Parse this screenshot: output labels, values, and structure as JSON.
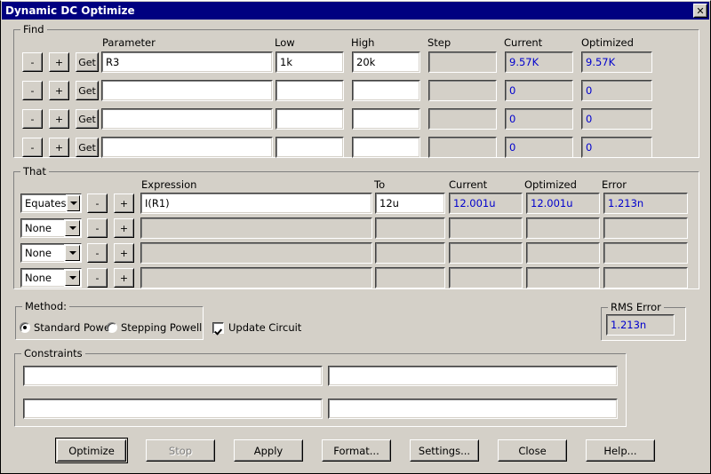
{
  "window": {
    "title": "Dynamic DC Optimize",
    "close_label": "✕"
  },
  "find": {
    "legend": "Find",
    "headers": {
      "parameter": "Parameter",
      "low": "Low",
      "high": "High",
      "step": "Step",
      "current": "Current",
      "optimized": "Optimized"
    },
    "button_minus": "-",
    "button_plus": "+",
    "button_get": "Get",
    "rows": [
      {
        "parameter": "R3",
        "low": "1k",
        "high": "20k",
        "step": "",
        "current": "9.57K",
        "optimized": "9.57K"
      },
      {
        "parameter": "",
        "low": "",
        "high": "",
        "step": "",
        "current": "0",
        "optimized": "0"
      },
      {
        "parameter": "",
        "low": "",
        "high": "",
        "step": "",
        "current": "0",
        "optimized": "0"
      },
      {
        "parameter": "",
        "low": "",
        "high": "",
        "step": "",
        "current": "0",
        "optimized": "0"
      }
    ]
  },
  "that": {
    "legend": "That",
    "headers": {
      "expression": "Expression",
      "to": "To",
      "current": "Current",
      "optimized": "Optimized",
      "error": "Error"
    },
    "button_minus": "-",
    "button_plus": "+",
    "rows": [
      {
        "mode": "Equates",
        "expression": "I(R1)",
        "to": "12u",
        "current": "12.001u",
        "optimized": "12.001u",
        "error": "1.213n"
      },
      {
        "mode": "None",
        "expression": "",
        "to": "",
        "current": "",
        "optimized": "",
        "error": ""
      },
      {
        "mode": "None",
        "expression": "",
        "to": "",
        "current": "",
        "optimized": "",
        "error": ""
      },
      {
        "mode": "None",
        "expression": "",
        "to": "",
        "current": "",
        "optimized": "",
        "error": ""
      }
    ]
  },
  "method": {
    "legend": "Method:",
    "options": [
      {
        "label": "Standard Powell",
        "selected": true
      },
      {
        "label": "Stepping Powell",
        "selected": false
      }
    ],
    "update_circuit": {
      "label": "Update Circuit",
      "checked": true
    }
  },
  "rms_error": {
    "legend": "RMS Error",
    "value": "1.213n"
  },
  "constraints": {
    "legend": "Constraints",
    "fields": [
      "",
      "",
      "",
      ""
    ]
  },
  "buttons": [
    {
      "label": "Optimize",
      "enabled": true,
      "default": true
    },
    {
      "label": "Stop",
      "enabled": false,
      "default": false
    },
    {
      "label": "Apply",
      "enabled": true,
      "default": false
    },
    {
      "label": "Format...",
      "enabled": true,
      "default": false
    },
    {
      "label": "Settings...",
      "enabled": true,
      "default": false
    },
    {
      "label": "Close",
      "enabled": true,
      "default": false
    },
    {
      "label": "Help...",
      "enabled": true,
      "default": false
    }
  ],
  "colors": {
    "titlebar": "#000080",
    "face": "#d4d0c8",
    "readonly_text": "#0000cd"
  }
}
